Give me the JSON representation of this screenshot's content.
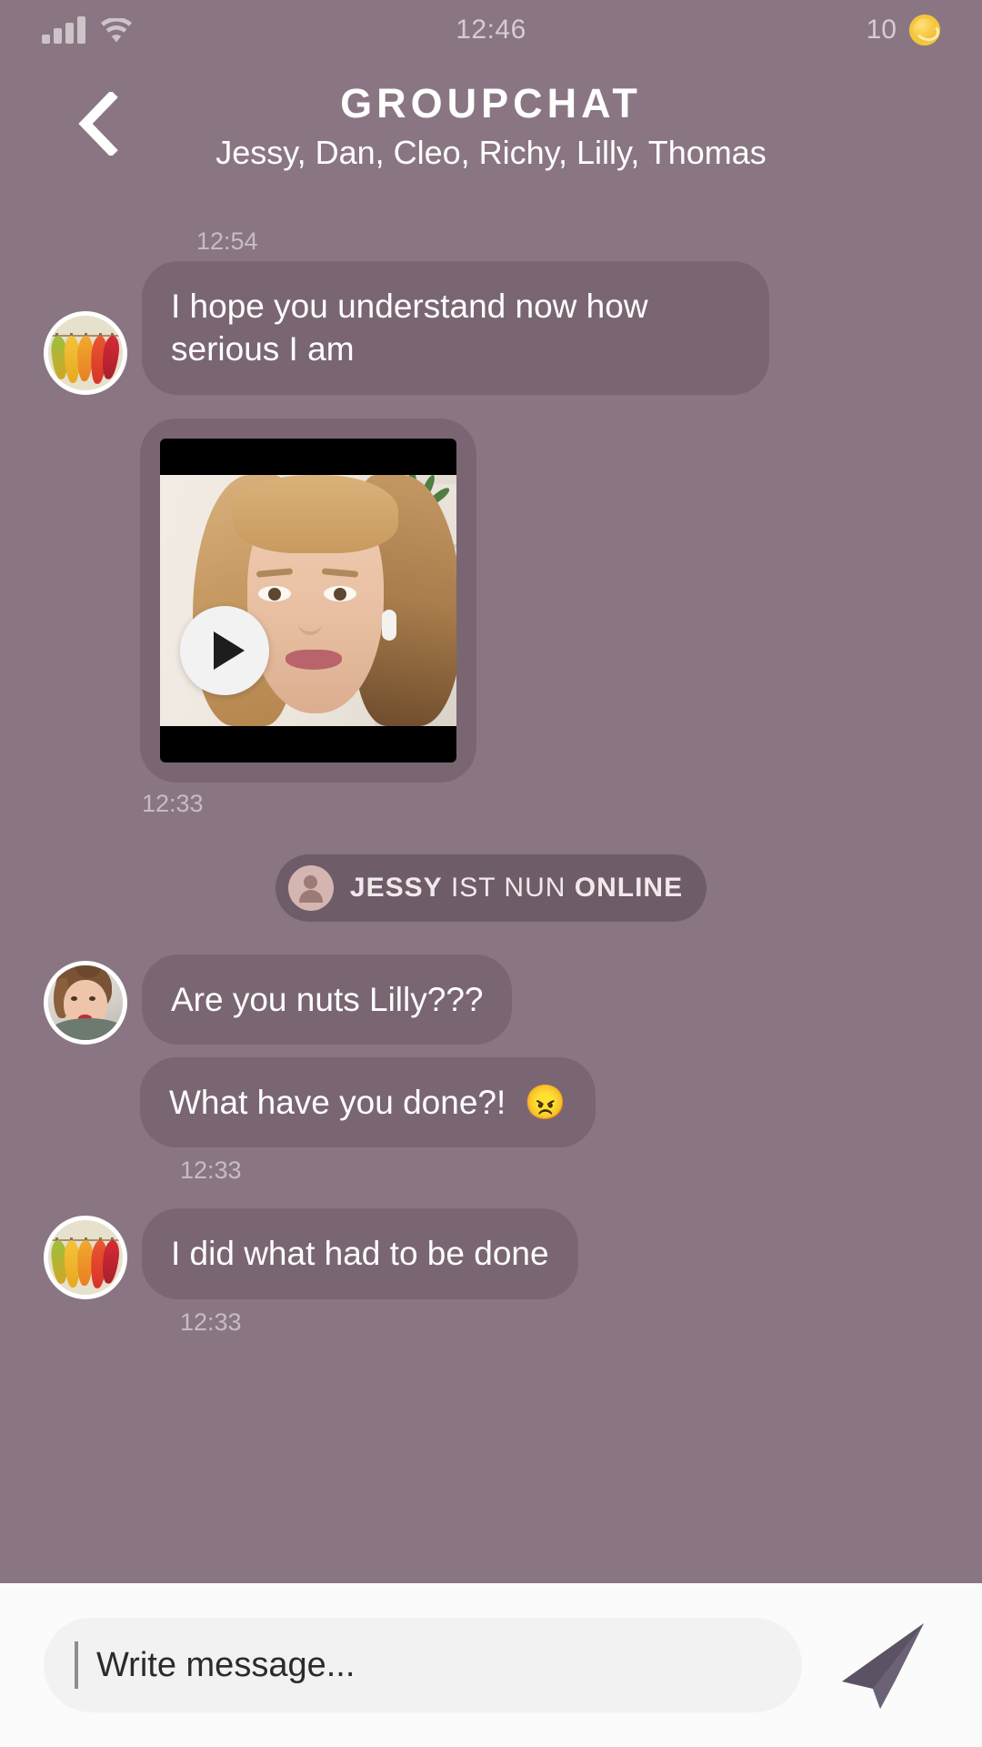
{
  "status_bar": {
    "time": "12:46",
    "coin_count": "10",
    "signal_icon": "signal-bars-icon",
    "wifi_icon": "wifi-icon",
    "coin_icon": "coin-icon"
  },
  "header": {
    "back_icon": "back-chevron-icon",
    "title": "GROUPCHAT",
    "participants": "Jessy, Dan, Cleo, Richy, Lilly, Thomas"
  },
  "conversation": {
    "top_timestamp": "12:54",
    "messages": [
      {
        "id": "msg-1",
        "sender": "Lilly",
        "avatar": "autumn-leaves-avatar",
        "text": "I hope you understand now how serious I am"
      },
      {
        "id": "msg-2-video",
        "type": "video",
        "play_icon": "play-icon",
        "timestamp": "12:33"
      },
      {
        "id": "msg-3",
        "sender": "Jessy",
        "avatar": "jessy-photo-avatar",
        "text": "Are you nuts Lilly???"
      },
      {
        "id": "msg-4",
        "sender": "Jessy",
        "text": "What have you done?!  😠",
        "timestamp": "12:33"
      },
      {
        "id": "msg-5",
        "sender": "Lilly",
        "avatar": "autumn-leaves-avatar",
        "text": "I did what had to be done",
        "timestamp": "12:33"
      }
    ],
    "online_notice": {
      "icon": "person-icon",
      "name": "JESSY",
      "middle": " IST NUN ",
      "state": "ONLINE"
    }
  },
  "input_bar": {
    "placeholder": "Write message...",
    "value": "",
    "send_icon": "send-paper-plane-icon"
  },
  "colors": {
    "background": "#8a7683",
    "bubble": "#7a6673",
    "pill": "#6e5c69",
    "text": "#ffffff",
    "timestamp": "#c6bcc3",
    "input_bar_bg": "#fbfbfb",
    "input_field_bg": "#f2f2f2",
    "send_icon": "#5b5263",
    "coin": "#f3c63c"
  }
}
